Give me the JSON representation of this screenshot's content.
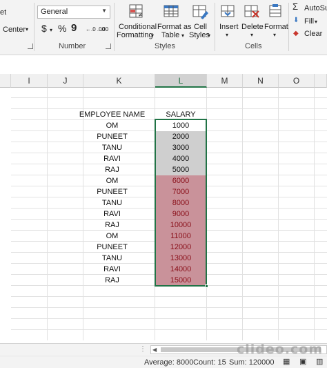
{
  "ribbon": {
    "clipped_left_text": "et",
    "merge_center_label": "Center",
    "number_format_value": "General",
    "currency_symbol": "$",
    "percent_symbol": "%",
    "comma_symbol": "9",
    "increase_decimal_label": "←.0 .00",
    "decrease_decimal_label": ".00 →.0",
    "number_group_label": "Number",
    "styles": {
      "conditional_formatting_line1": "Conditional",
      "conditional_formatting_line2": "Formatting",
      "format_as_table_line1": "Format as",
      "format_as_table_line2": "Table",
      "cell_styles_line1": "Cell",
      "cell_styles_line2": "Styles",
      "group_label": "Styles"
    },
    "cells": {
      "insert_label": "Insert",
      "delete_label": "Delete",
      "format_label": "Format",
      "group_label": "Cells"
    },
    "editing": {
      "autosum_label": "AutoSu",
      "fill_label": "Fill",
      "clear_label": "Clear"
    }
  },
  "columns": [
    "I",
    "J",
    "K",
    "L",
    "M",
    "N",
    "O"
  ],
  "selected_column": "L",
  "table": {
    "header_name": "EMPLOYEE NAME",
    "header_salary": "SALARY",
    "rows": [
      {
        "name": "OM",
        "salary": "1000"
      },
      {
        "name": "PUNEET",
        "salary": "2000"
      },
      {
        "name": "TANU",
        "salary": "3000"
      },
      {
        "name": "RAVI",
        "salary": "4000"
      },
      {
        "name": "RAJ",
        "salary": "5000"
      },
      {
        "name": "OM",
        "salary": "6000"
      },
      {
        "name": "PUNEET",
        "salary": "7000"
      },
      {
        "name": "TANU",
        "salary": "8000"
      },
      {
        "name": "RAVI",
        "salary": "9000"
      },
      {
        "name": "RAJ",
        "salary": "10000"
      },
      {
        "name": "OM",
        "salary": "11000"
      },
      {
        "name": "PUNEET",
        "salary": "12000"
      },
      {
        "name": "TANU",
        "salary": "13000"
      },
      {
        "name": "RAVI",
        "salary": "14000"
      },
      {
        "name": "RAJ",
        "salary": "15000"
      }
    ]
  },
  "status": {
    "average": "Average: 8000",
    "count": "Count: 15",
    "sum": "Sum: 120000"
  },
  "watermark": "clideo.com",
  "colors": {
    "excel_green": "#217346",
    "highlight_red_fill": "#c9929a",
    "highlight_red_text": "#8a0f19",
    "highlight_grey_fill": "#cfcfcf"
  }
}
